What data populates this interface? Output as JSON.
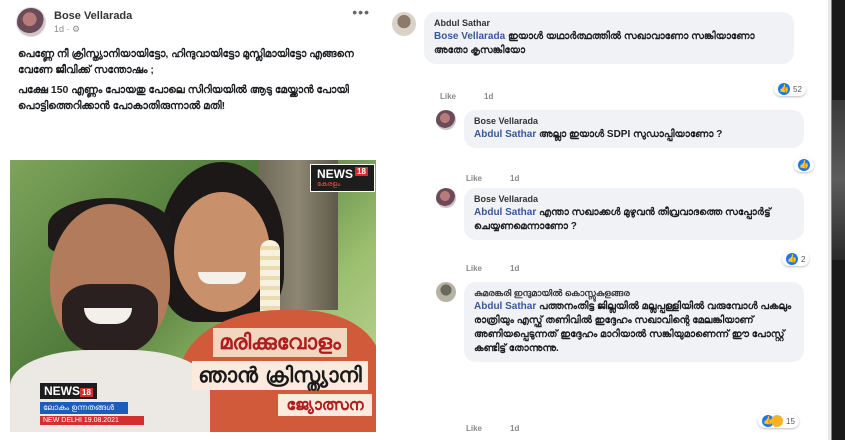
{
  "post": {
    "author": "Bose Vellarada",
    "meta": "1d · ⚙",
    "more": "•••",
    "paragraphs": [
      "പെണ്ണേ നീ ക്രിസ്ത്യാനിയായിട്ടോ, ഹിന്ദുവായിട്ടോ മുസ്ലിമായിട്ടോ എങ്ങനെ വേണേ ജീവിക്ക് സന്തോഷം ;",
      "പക്ഷേ 150 എണ്ണം പോയതു പോലെ സിറിയയിൽ ആടു മേയ്ക്കാൻ പോയി പൊട്ടിത്തെറിക്കാൻ പോകാതിരുന്നാൽ മതി!"
    ],
    "image": {
      "news_logo_top": "NEWS",
      "news_logo_top_num": "18",
      "news_logo_top_sub": "കേരളം",
      "headline_line1": "മരിക്കുവോളം",
      "headline_line2": "ഞാൻ ക്രിസ്ത്യാനി",
      "headline_line3": "ജ്യോത്സന",
      "news_logo_bottom": "NEWS",
      "news_logo_bottom_num": "18",
      "news_logo_bottom_tag": "ലോകം ഉന്നതങ്ങൾ",
      "news_logo_bottom_date": "NEW DELHI 19.08.2021"
    }
  },
  "comments": [
    {
      "author": "Abdul Sathar",
      "reply_to": "Bose Vellarada",
      "body": "ഇയാൾ യഥാർത്ഥത്തിൽ സഖാവാണോ സങ്കിയാണോ അതോ കൃസങ്കിയോ",
      "like": "Like",
      "time": "1d",
      "reactions": "52"
    },
    {
      "author": "Bose Vellarada",
      "reply_to": "Abdul Sathar",
      "body": "അല്ലാ ഇയാൾ SDPI സുഡാപ്പിയാണോ ?",
      "like": "Like",
      "time": "1d",
      "reactions": ""
    },
    {
      "author": "Bose Vellarada",
      "reply_to": "Abdul Sathar",
      "body": "എന്താ സഖാക്കൾ മുഴുവൻ തീവ്രവാദത്തെ സപ്പോർട്ട് ചെയ്യണമെന്നാണോ ?",
      "like": "Like",
      "time": "1d",
      "reactions": "2"
    },
    {
      "author": "കുമരങ്കരി ഇന്ദുമായിൽ കൊസ്സുകുളങ്ങര",
      "reply_to": "Abdul Sathar",
      "body": "പത്തനംതിട്ട ജില്ലയിൽ മല്ലപ്പള്ളിയിൽ വരുമ്പോൾ പകലും രാത്രിയും എസ്ഫ് തണിവിൽ ഇദ്ദേഹം സഖാവിന്റെ മേലങ്കിയാണ് അണിയപ്പെടുന്നത് ഇദ്ദേഹം മാറിയാൽ സങ്കിയുമാണെന്ന് ഈ പോസ്റ്റ് കണ്ടിട്ട് തോന്നുന്നു.",
      "like": "Like",
      "time": "1d",
      "reactions": "15"
    }
  ],
  "colors": {
    "bubble": "#f0f2f5",
    "link": "#385898",
    "like_blue": "#1877f2",
    "news_red": "#d32f2f"
  }
}
